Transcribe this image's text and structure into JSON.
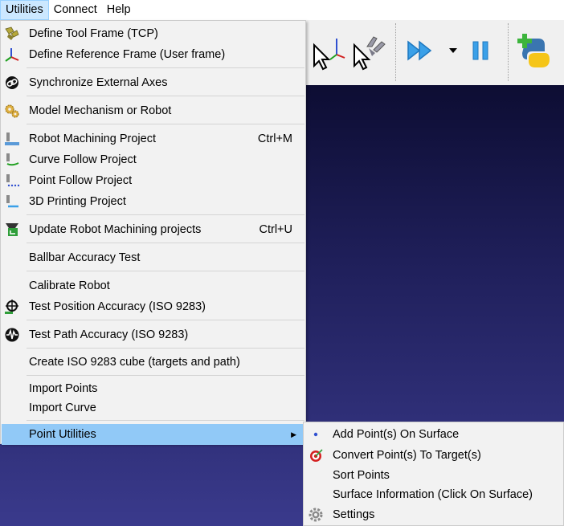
{
  "menubar": {
    "utilities": "Utilities",
    "connect": "Connect",
    "help": "Help"
  },
  "menu": {
    "define_tcp": "Define Tool Frame (TCP)",
    "define_ref": "Define Reference Frame (User frame)",
    "sync_axes": "Synchronize External Axes",
    "model_mech": "Model Mechanism or Robot",
    "robot_machining": "Robot Machining Project",
    "robot_machining_sc": "Ctrl+M",
    "curve_follow": "Curve Follow Project",
    "point_follow": "Point Follow Project",
    "printing_3d": "3D Printing Project",
    "update_machining": "Update Robot Machining projects",
    "update_machining_sc": "Ctrl+U",
    "ballbar": "Ballbar Accuracy Test",
    "calibrate": "Calibrate Robot",
    "test_position": "Test Position Accuracy (ISO 9283)",
    "test_path": "Test Path Accuracy (ISO 9283)",
    "create_cube": "Create ISO 9283 cube (targets and path)",
    "import_points": "Import Points",
    "import_curve": "Import Curve",
    "point_utilities": "Point Utilities"
  },
  "submenu": {
    "add_points": "Add Point(s) On Surface",
    "convert_points": "Convert Point(s) To Target(s)",
    "sort_points": "Sort Points",
    "surface_info": "Surface Information (Click On Surface)",
    "settings": "Settings"
  },
  "colors": {
    "highlight": "#91c9f7",
    "viewport_top": "#0d0d33",
    "viewport_bottom": "#3a3a8c"
  }
}
